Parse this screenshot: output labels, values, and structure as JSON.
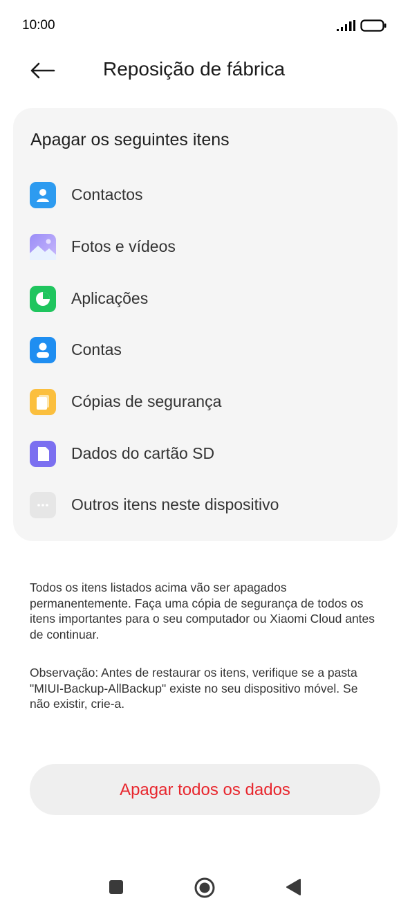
{
  "status_bar": {
    "time": "10:00",
    "icons": [
      "signal-icon",
      "battery-icon"
    ]
  },
  "header": {
    "back_icon": "arrow-left-icon",
    "title": "Reposição de fábrica"
  },
  "card": {
    "title": "Apagar os seguintes itens",
    "items": [
      {
        "label": "Contactos",
        "icon": "contacts-icon",
        "color": "#2d9bf0"
      },
      {
        "label": "Fotos e vídeos",
        "icon": "gallery-icon",
        "color": "#8e8cf5"
      },
      {
        "label": "Aplicações",
        "icon": "apps-icon",
        "color": "#1fc55e"
      },
      {
        "label": "Contas",
        "icon": "account-icon",
        "color": "#1f8ef1"
      },
      {
        "label": "Cópias de segurança",
        "icon": "backup-icon",
        "color": "#fbbf3e"
      },
      {
        "label": "Dados do cartão SD",
        "icon": "sd-card-icon",
        "color": "#7b6ff0"
      },
      {
        "label": "Outros itens neste dispositivo",
        "icon": "more-icon",
        "color": "#e6e6e6"
      }
    ]
  },
  "notes": {
    "warning": "Todos os itens listados acima vão ser apagados permanentemente. Faça uma cópia de segurança de todos os itens importantes para o seu computador ou Xiaomi Cloud antes de continuar.",
    "observation": "Observação: Antes de restaurar os itens, verifique se a pasta \"MIUI-Backup-AllBackup\" existe no seu dispositivo móvel. Se não existir, crie-a."
  },
  "actions": {
    "erase_label": "Apagar todos os dados",
    "erase_color": "#e8262d"
  },
  "nav_bar": {
    "buttons": [
      "recents-icon",
      "home-icon",
      "back-icon"
    ]
  }
}
